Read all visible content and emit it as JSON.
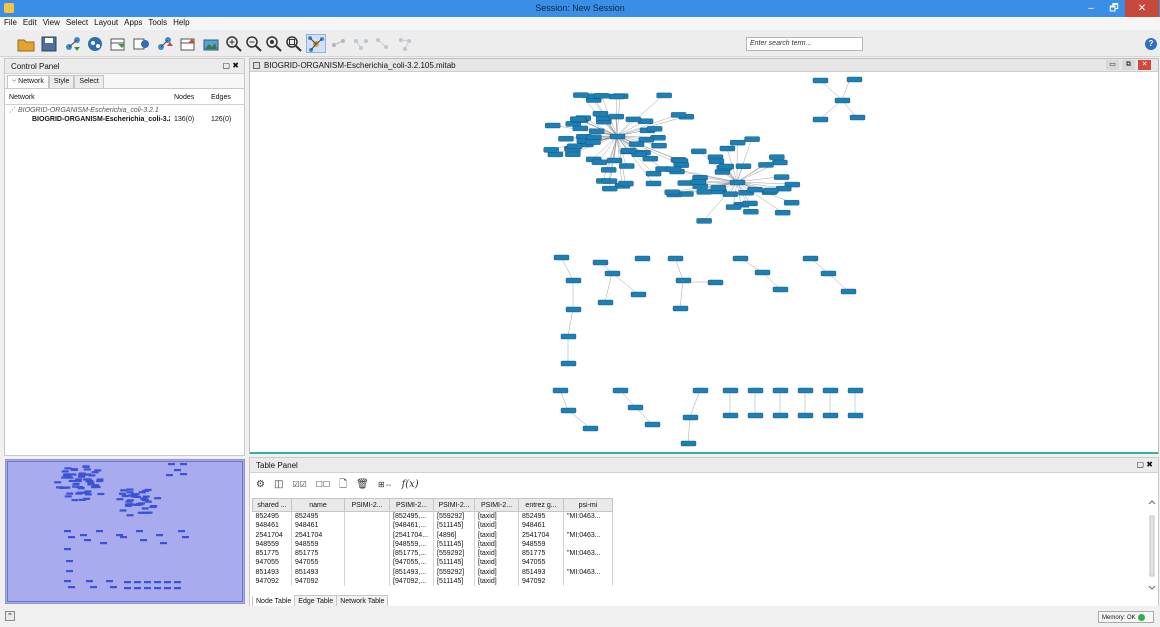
{
  "window": {
    "title": "Session: New Session",
    "minimize": "–",
    "maximize": "🗗",
    "close": "✕"
  },
  "menu": [
    "File",
    "Edit",
    "View",
    "Select",
    "Layout",
    "Apps",
    "Tools",
    "Help"
  ],
  "search": {
    "placeholder": "Enter search term..."
  },
  "help_label": "?",
  "control_panel": {
    "title": "Control Panel",
    "tabs": [
      "Network",
      "Style",
      "Select"
    ],
    "columns": {
      "network": "Network",
      "nodes": "Nodes",
      "edges": "Edges"
    },
    "collection": "BIOGRID-ORGANISM-Escherichia_coli-3.2.1",
    "network_name": "BIOGRID-ORGANISM-Escherichia_coli-3.2",
    "nodes": "136(0)",
    "edges": "126(0)"
  },
  "network_view": {
    "title": "BIOGRID-ORGANISM-Escherichia_coli-3.2.105.mitab"
  },
  "table_panel": {
    "title": "Table Panel",
    "columns": [
      "shared ...",
      "name",
      "PSIMI-2...",
      "PSIMI-2...",
      "PSIMI-2...",
      "PSIMI-2...",
      "entrez g...",
      "psi-mi"
    ],
    "rows": [
      [
        "852495",
        "852495",
        "",
        "[852495,...",
        "[559292]",
        "[taxid]",
        "852495",
        "\"MI:0463..."
      ],
      [
        "948461",
        "948461",
        "",
        "[948461,...",
        "[511145]",
        "[taxid]",
        "948461",
        ""
      ],
      [
        "2541704",
        "2541704",
        "",
        "[2541704...",
        "[4896]",
        "[taxid]",
        "2541704",
        "\"MI:0463..."
      ],
      [
        "948559",
        "948559",
        "",
        "[948559,...",
        "[511145]",
        "[taxid]",
        "948559",
        ""
      ],
      [
        "851775",
        "851775",
        "",
        "[851775,...",
        "[559292]",
        "[taxid]",
        "851775",
        "\"MI:0463..."
      ],
      [
        "947055",
        "947055",
        "",
        "[947055,...",
        "[511145]",
        "[taxid]",
        "947055",
        ""
      ],
      [
        "851493",
        "851493",
        "",
        "[851493,...",
        "[559292]",
        "[taxid]",
        "851493",
        "\"MI:0463..."
      ],
      [
        "947092",
        "947092",
        "",
        "[947092,...",
        "[511145]",
        "[taxid]",
        "947092",
        ""
      ]
    ],
    "bottom_tabs": [
      "Node Table",
      "Edge Table",
      "Network Table"
    ]
  },
  "status": {
    "memory": "Memory: OK"
  },
  "colors": {
    "node_fill": "#1e7fb5",
    "node_border": "#0b4f78",
    "edge": "#8a8a8a",
    "accent_bar": "#3aaea1",
    "title_bar": "#3a8ee6",
    "overview_bg": "#a8acef",
    "overview_node": "#3b52d6"
  }
}
